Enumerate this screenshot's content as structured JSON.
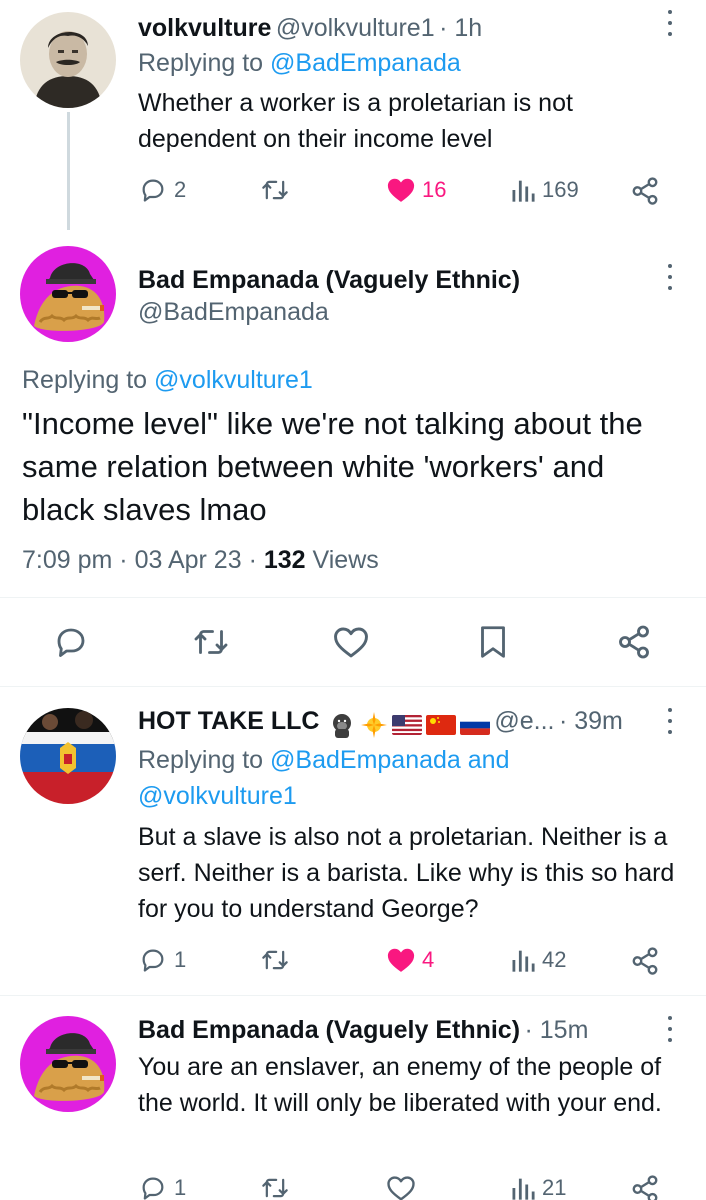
{
  "tweets": [
    {
      "name": "volkvulture",
      "handle": "@volkvulture1",
      "time": "· 1h",
      "replying_prefix": "Replying to ",
      "replying_to": "@BadEmpanada",
      "text": "Whether a worker is a proletarian is not dependent on their income level",
      "replies": "2",
      "retweets": "",
      "likes": "16",
      "views": "169",
      "liked": true,
      "avatar_icon": "portrait-avatar"
    },
    {
      "name": "Bad Empanada (Vaguely Ethnic)",
      "handle": "@BadEmpanada",
      "replying_prefix": "Replying to ",
      "replying_to": "@volkvulture1",
      "text": "\"Income level\" like we're not talking about the same relation between white 'workers' and black slaves lmao",
      "time_full": "7:09 pm",
      "date": "03 Apr 23",
      "views_count": "132",
      "views_label": "Views",
      "avatar_icon": "empanada-avatar"
    },
    {
      "name": "HOT TAKE LLC",
      "handle": "@e...",
      "time": "· 39m",
      "replying_prefix": "Replying to ",
      "replying_to": "@BadEmpanada and",
      "replying_to_2": "@volkvulture1",
      "text": "But a slave is also not a proletarian. Neither is a serf. Neither is a barista. Like why is this so hard for you to understand George?",
      "replies": "1",
      "retweets": "",
      "likes": "4",
      "views": "42",
      "liked": true,
      "avatar_icon": "flag-avatar",
      "name_emojis": [
        "gorilla-icon",
        "sparkle-icon",
        "us-flag-icon",
        "china-flag-icon",
        "russia-flag-icon"
      ]
    },
    {
      "name": "Bad Empanada (Vaguely Ethnic)",
      "time": "· 15m",
      "text": "You are an enslaver, an enemy of the people of the world. It will only be liberated with your end.",
      "replies": "1",
      "retweets": "",
      "likes": "",
      "views": "21",
      "liked": false,
      "avatar_icon": "empanada-avatar"
    }
  ],
  "colors": {
    "accent": "#1d9bf0",
    "like": "#f91880",
    "muted": "#536471",
    "text": "#0f1419",
    "divider": "#eff3f4"
  }
}
